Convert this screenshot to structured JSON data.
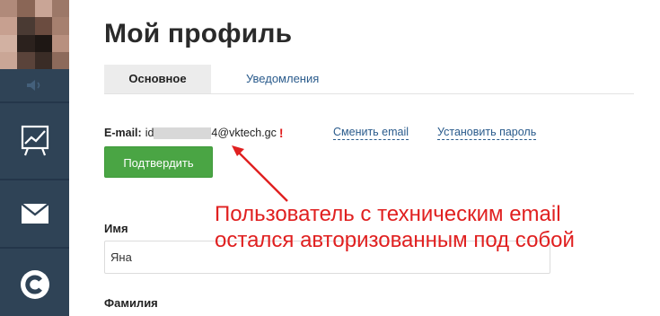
{
  "page": {
    "title": "Мой профиль"
  },
  "tabs": [
    {
      "label": "Основное",
      "active": true
    },
    {
      "label": "Уведомления",
      "active": false
    }
  ],
  "email": {
    "label": "E-mail:",
    "value_prefix": "id",
    "value_suffix": "4@vktech.gc",
    "warning_mark": "!",
    "change_link": "Сменить email",
    "set_password_link": "Установить пароль"
  },
  "confirm_button": {
    "label": "Подтвердить"
  },
  "form": {
    "name_label": "Имя",
    "name_value": "Яна",
    "surname_label": "Фамилия"
  },
  "annotation": {
    "line1": "Пользователь с техническим email",
    "line2": "остался авторизованным под собой"
  },
  "sidebar": {
    "items": [
      {
        "icon": "volume-icon"
      },
      {
        "icon": "chart-icon"
      },
      {
        "icon": "mail-icon"
      },
      {
        "icon": "c-logo-icon"
      }
    ]
  },
  "colors": {
    "sidebar": "#2f4356",
    "accent_green": "#4aa544",
    "link": "#2a5b8c",
    "annotation": "#e02020"
  }
}
